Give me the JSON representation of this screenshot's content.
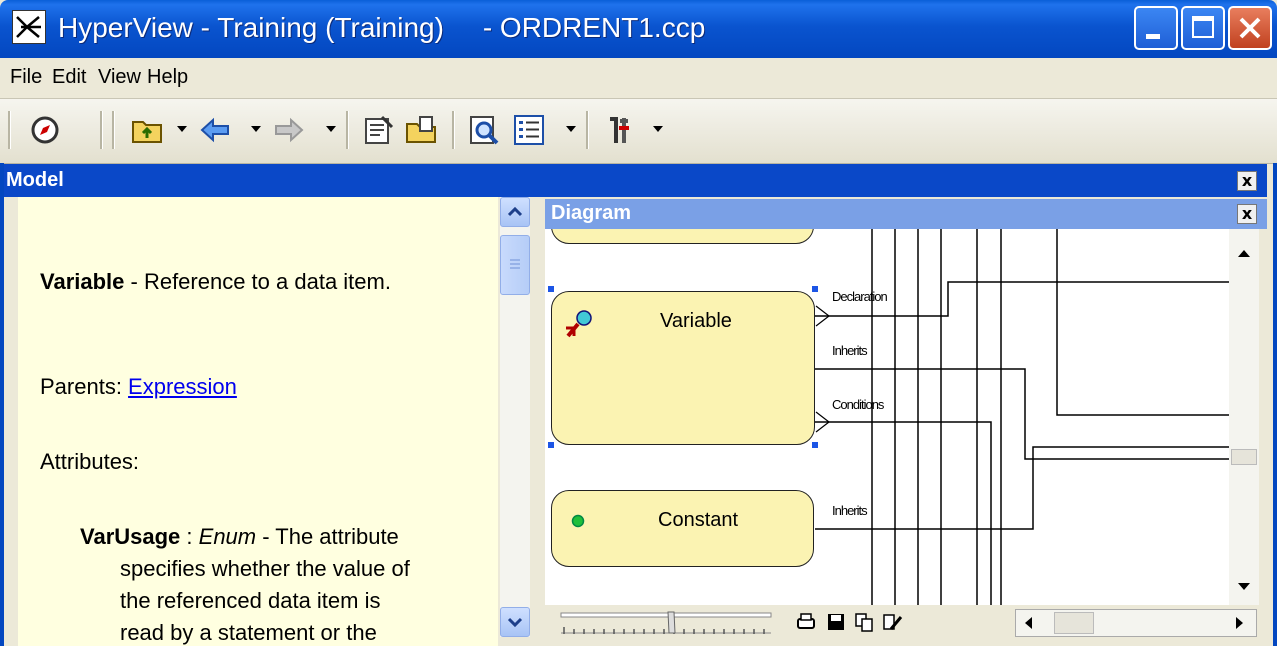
{
  "window": {
    "title": "HyperView - Training (Training)     - ORDRENT1.ccp",
    "icon": "hyperview-app-icon"
  },
  "menu": [
    "File",
    "Edit",
    "View",
    "Help"
  ],
  "toolbar": {
    "icons": [
      "compass-icon",
      "folder-up-icon",
      "back-arrow-icon",
      "forward-arrow-icon",
      "properties-icon",
      "open-folder-icon",
      "preview-icon",
      "list-icon",
      "tools-icon"
    ]
  },
  "model_pane": {
    "title": "Model",
    "close_label": "x",
    "term": "Variable",
    "term_desc": " - Reference to a data item.",
    "parents_label": "Parents: ",
    "parents_link": "Expression",
    "attributes_label": "Attributes:",
    "attr_name": "VarUsage",
    "attr_sep": " : ",
    "attr_type": "Enum",
    "attr_desc_1": " - The attribute",
    "attr_desc_2": "specifies whether the value of",
    "attr_desc_3": "the referenced data item is",
    "attr_desc_4": "read by a statement or the"
  },
  "diagram_pane": {
    "title": "Diagram",
    "close_label": "x",
    "nodes": [
      {
        "label": "Variable",
        "icon": "variable-icon"
      },
      {
        "label": "Constant",
        "icon": "constant-icon"
      }
    ],
    "edge_labels": [
      "Declaration",
      "Inherits",
      "Conditions",
      "Inherits"
    ],
    "bottom_icons": [
      "print-icon",
      "save-icon",
      "copy-icon",
      "edit-icon"
    ]
  },
  "colors": {
    "titlebar": "#0a54cf",
    "pane_header": "#0a48c8",
    "diagram_header": "#7aa0e6",
    "left_bg": "#ffffe0",
    "node_fill": "#fbf3b2",
    "link": "#0000ee"
  }
}
